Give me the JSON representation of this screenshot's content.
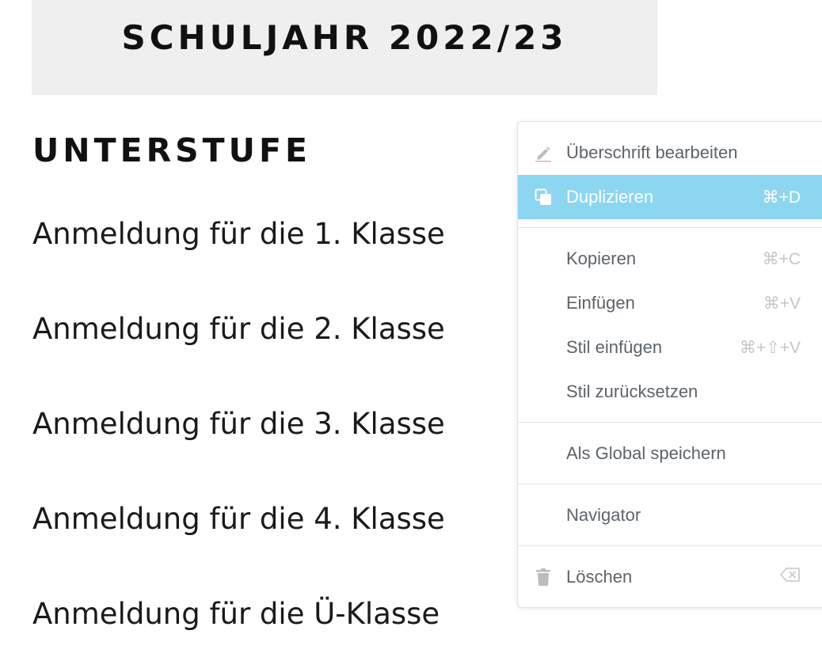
{
  "page": {
    "banner_title": "SCHULJAHR 2022/23",
    "section_heading": "UNTERSTUFE",
    "links": [
      "Anmeldung für die 1. Klasse",
      "Anmeldung für die 2. Klasse",
      "Anmeldung für die 3. Klasse",
      "Anmeldung für die 4. Klasse",
      "Anmeldung für die Ü-Klasse"
    ]
  },
  "context_menu": {
    "accent_color": "#8cd6f2",
    "items": [
      {
        "label": "Überschrift bearbeiten",
        "shortcut": "",
        "icon": "pencil-icon",
        "active": false
      },
      {
        "label": "Duplizieren",
        "shortcut": "⌘+D",
        "icon": "duplicate-icon",
        "active": true
      },
      {
        "label": "Kopieren",
        "shortcut": "⌘+C",
        "icon": "",
        "active": false
      },
      {
        "label": "Einfügen",
        "shortcut": "⌘+V",
        "icon": "",
        "active": false
      },
      {
        "label": "Stil einfügen",
        "shortcut": "⌘+⇧+V",
        "icon": "",
        "active": false
      },
      {
        "label": "Stil zurücksetzen",
        "shortcut": "",
        "icon": "",
        "active": false
      },
      {
        "label": "Als Global speichern",
        "shortcut": "",
        "icon": "",
        "active": false
      },
      {
        "label": "Navigator",
        "shortcut": "",
        "icon": "",
        "active": false
      },
      {
        "label": "Löschen",
        "shortcut": "",
        "icon": "trash-icon",
        "shortcut_icon": "delete-key-icon",
        "active": false
      }
    ]
  }
}
